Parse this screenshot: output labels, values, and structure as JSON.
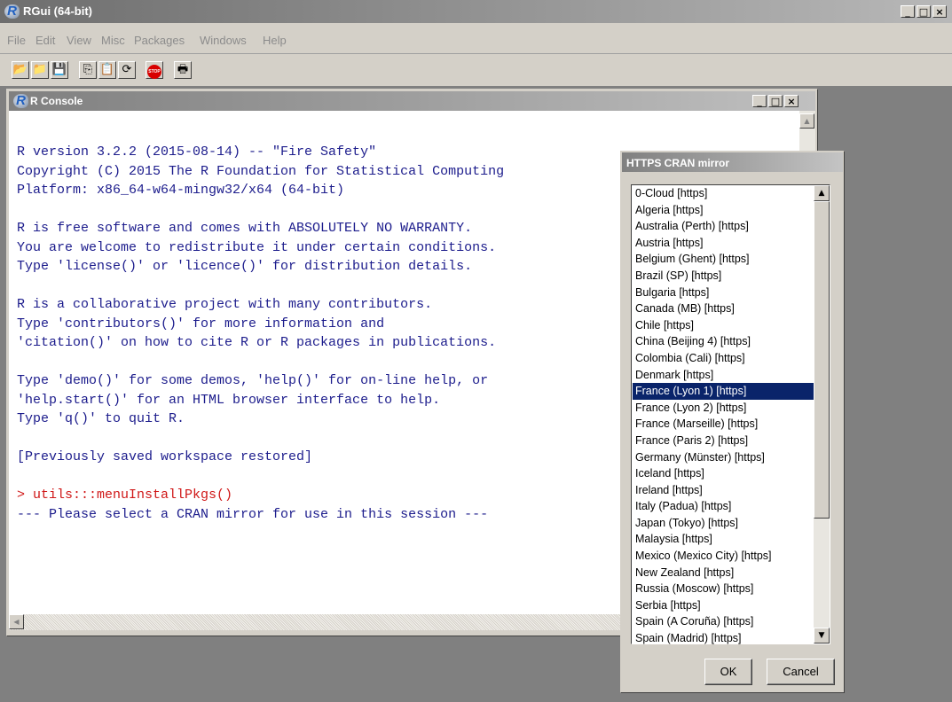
{
  "app": {
    "title": "RGui (64-bit)",
    "logo": "R",
    "window_buttons": [
      "_",
      "□",
      "×"
    ]
  },
  "menubar": {
    "items": [
      "File",
      "Edit",
      "View",
      "Misc",
      "Packages",
      "Windows",
      "Help"
    ]
  },
  "toolbar": {
    "buttons": [
      {
        "name": "open-script-icon",
        "glyph": "📂"
      },
      {
        "name": "load-workspace-icon",
        "glyph": "📁"
      },
      {
        "name": "save-icon",
        "glyph": "💾"
      },
      {
        "name": "copy-icon",
        "glyph": "⎘"
      },
      {
        "name": "paste-icon",
        "glyph": "📋"
      },
      {
        "name": "copy-paste-icon",
        "glyph": "⟳"
      },
      {
        "name": "stop-icon",
        "glyph": "STOP"
      },
      {
        "name": "print-icon",
        "glyph": "🖶"
      }
    ]
  },
  "console": {
    "title": "R Console",
    "logo": "R",
    "lines": [
      "R version 3.2.2 (2015-08-14) -- \"Fire Safety\"",
      "Copyright (C) 2015 The R Foundation for Statistical Computing",
      "Platform: x86_64-w64-mingw32/x64 (64-bit)",
      "",
      "R is free software and comes with ABSOLUTELY NO WARRANTY.",
      "You are welcome to redistribute it under certain conditions.",
      "Type 'license()' or 'licence()' for distribution details.",
      "",
      "R is a collaborative project with many contributors.",
      "Type 'contributors()' for more information and",
      "'citation()' on how to cite R or R packages in publications.",
      "",
      "Type 'demo()' for some demos, 'help()' for on-line help, or",
      "'help.start()' for an HTML browser interface to help.",
      "Type 'q()' to quit R.",
      "",
      "[Previously saved workspace restored]",
      ""
    ],
    "command": "> utils:::menuInstallPkgs()",
    "message": "--- Please select a CRAN mirror for use in this session ---",
    "colors": {
      "output": "#1c1c8c",
      "command": "#d01818"
    }
  },
  "dialog": {
    "title": "HTTPS CRAN mirror",
    "mirrors": [
      "0-Cloud [https]",
      "Algeria [https]",
      "Australia (Perth) [https]",
      "Austria [https]",
      "Belgium (Ghent) [https]",
      "Brazil (SP) [https]",
      "Bulgaria [https]",
      "Canada (MB) [https]",
      "Chile [https]",
      "China (Beijing 4) [https]",
      "Colombia (Cali) [https]",
      "Denmark [https]",
      "France (Lyon 1) [https]",
      "France (Lyon 2) [https]",
      "France (Marseille) [https]",
      "France (Paris 2) [https]",
      "Germany (Münster) [https]",
      "Iceland [https]",
      "Ireland [https]",
      "Italy (Padua) [https]",
      "Japan (Tokyo) [https]",
      "Malaysia [https]",
      "Mexico (Mexico City) [https]",
      "New Zealand [https]",
      "Russia (Moscow) [https]",
      "Serbia [https]",
      "Spain (A Coruña) [https]",
      "Spain (Madrid) [https]"
    ],
    "selected": "France (Lyon 1) [https]",
    "ok_label": "OK",
    "cancel_label": "Cancel",
    "colors": {
      "selection": "#0a246a"
    }
  }
}
